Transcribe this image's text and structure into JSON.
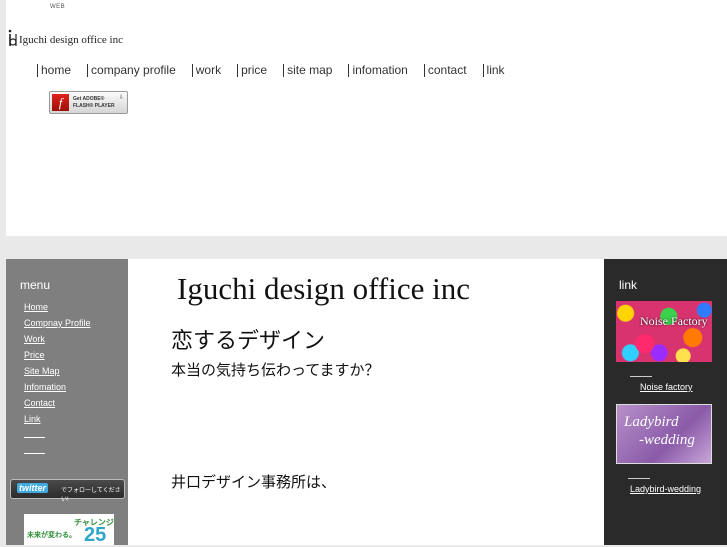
{
  "header": {
    "tag": "WEB",
    "logo_text": "Iguchi design office inc",
    "nav": [
      {
        "label": "home"
      },
      {
        "label": "company profile"
      },
      {
        "label": "work"
      },
      {
        "label": "price"
      },
      {
        "label": "site map"
      },
      {
        "label": "infomation"
      },
      {
        "label": "contact"
      },
      {
        "label": "link"
      }
    ],
    "flash": {
      "line1": "Get ADOBE®",
      "line2": "FLASH® PLAYER",
      "icon": "flash-player-icon"
    }
  },
  "left": {
    "title": "menu",
    "links": [
      {
        "label": "Home"
      },
      {
        "label": "Compnay Profile"
      },
      {
        "label": "Work"
      },
      {
        "label": "Price"
      },
      {
        "label": "Site Map"
      },
      {
        "label": "Infomation"
      },
      {
        "label": "Contact"
      },
      {
        "label": "Link"
      }
    ],
    "twitter": {
      "logo": "twitter",
      "text": "でフォローしてください!"
    },
    "challenge": {
      "line1": "チャレンジ",
      "line2": "未来が変わる。",
      "number": "25"
    }
  },
  "main": {
    "title": "Iguchi design office inc",
    "heading": "恋するデザイン",
    "sub": "本当の気持ち伝わってますか？",
    "para": "井口デザイン事務所は、"
  },
  "right": {
    "title": "link",
    "items": [
      {
        "img_text": "Noise Factory",
        "label": "Noise factory"
      },
      {
        "img_line1": "Ladybird",
        "img_line2": "-wedding",
        "label": "Ladybird-wedding"
      }
    ]
  }
}
